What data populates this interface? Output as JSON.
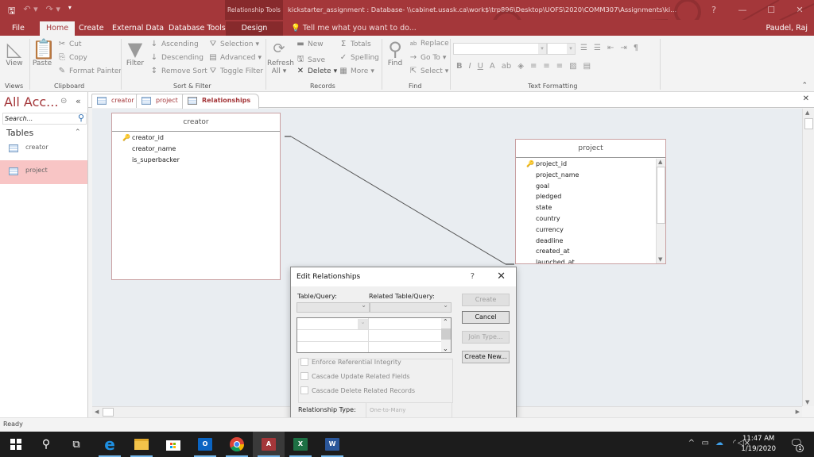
{
  "titlebar": {
    "qat": {
      "save_icon": "save-icon",
      "undo_icon": "undo-icon",
      "redo_icon": "redo-icon",
      "customize_icon": "customize-qat-icon"
    },
    "context_tool": "Relationship Tools",
    "title": "kickstarter_assignment : Database- \\\\cabinet.usask.ca\\work$\\trp896\\Desktop\\UOFS\\2020\\COMM307\\Assignments\\ki...",
    "help": "?",
    "minimize": "—",
    "restore": "☐",
    "close": "✕"
  },
  "tabs": {
    "items": [
      {
        "label": "File"
      },
      {
        "label": "Home"
      },
      {
        "label": "Create"
      },
      {
        "label": "External Data"
      },
      {
        "label": "Database Tools"
      },
      {
        "label": "Design"
      }
    ],
    "active": "Home",
    "tell_me": "Tell me what you want to do...",
    "user": "Paudel, Raj"
  },
  "ribbon": {
    "views": {
      "view": "View",
      "label": "Views"
    },
    "clipboard": {
      "paste": "Paste",
      "cut": "Cut",
      "copy": "Copy",
      "format_painter": "Format Painter",
      "label": "Clipboard"
    },
    "sort_filter": {
      "filter": "Filter",
      "ascending": "Ascending",
      "descending": "Descending",
      "remove_sort": "Remove Sort",
      "selection": "Selection",
      "advanced": "Advanced",
      "toggle_filter": "Toggle Filter",
      "label": "Sort & Filter"
    },
    "records": {
      "refresh_all": "Refresh",
      "refresh_all_2": "All",
      "new": "New",
      "save": "Save",
      "delete": "Delete",
      "totals": "Totals",
      "spelling": "Spelling",
      "more": "More",
      "label": "Records"
    },
    "find": {
      "find": "Find",
      "replace": "Replace",
      "go_to": "Go To",
      "select": "Select",
      "label": "Find"
    },
    "text_formatting": {
      "bold": "B",
      "italic": "I",
      "underline": "U",
      "font_color": "A",
      "label": "Text Formatting"
    }
  },
  "nav": {
    "title": "All Acc...",
    "search_placeholder": "Search...",
    "group": "Tables",
    "items": [
      {
        "label": "creator",
        "selected": false
      },
      {
        "label": "project",
        "selected": true
      }
    ]
  },
  "doc_tabs": [
    {
      "label": "creator"
    },
    {
      "label": "project"
    },
    {
      "label": "Relationships",
      "active": true
    }
  ],
  "tables": {
    "creator": {
      "title": "creator",
      "fields": [
        {
          "name": "creator_id",
          "key": true
        },
        {
          "name": "creator_name",
          "key": false
        },
        {
          "name": "is_superbacker",
          "key": false
        }
      ]
    },
    "project": {
      "title": "project",
      "fields": [
        {
          "name": "project_id",
          "key": true
        },
        {
          "name": "project_name",
          "key": false
        },
        {
          "name": "goal",
          "key": false
        },
        {
          "name": "pledged",
          "key": false
        },
        {
          "name": "state",
          "key": false
        },
        {
          "name": "country",
          "key": false
        },
        {
          "name": "currency",
          "key": false
        },
        {
          "name": "deadline",
          "key": false
        },
        {
          "name": "created_at",
          "key": false
        },
        {
          "name": "launched_at",
          "key": false
        }
      ]
    }
  },
  "dialog": {
    "title": "Edit Relationships",
    "help": "?",
    "close": "✕",
    "table_query_label": "Table/Query:",
    "related_label": "Related Table/Query:",
    "table_query_value": "",
    "related_value": "",
    "buttons": {
      "create": "Create",
      "cancel": "Cancel",
      "join_type": "Join Type...",
      "create_new": "Create New..."
    },
    "checkboxes": [
      {
        "label": "Enforce Referential Integrity",
        "checked": false
      },
      {
        "label": "Cascade Update Related Fields",
        "checked": false
      },
      {
        "label": "Cascade Delete Related Records",
        "checked": false
      }
    ],
    "relationship_type_label": "Relationship Type:",
    "relationship_type_value": "One-to-Many"
  },
  "status": {
    "text": "Ready"
  },
  "taskbar": {
    "apps": [
      "start",
      "search",
      "task-view",
      "edge",
      "file-explorer",
      "store",
      "outlook",
      "chrome",
      "access",
      "excel",
      "word"
    ],
    "time": "11:47 AM",
    "date": "1/19/2020",
    "notifications": "1"
  }
}
